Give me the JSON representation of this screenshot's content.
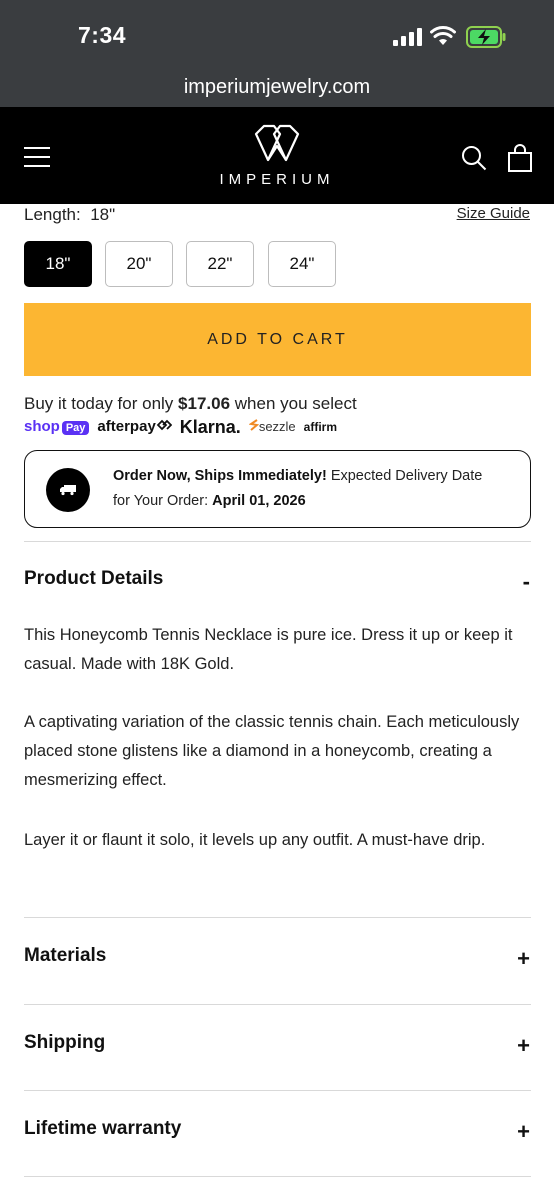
{
  "status_bar": {
    "time": "7:34"
  },
  "browser": {
    "url": "imperiumjewelry.com"
  },
  "header": {
    "brand": "IMPERIUM"
  },
  "product": {
    "length_label": "Length:",
    "length_value": "18\"",
    "size_guide": "Size Guide",
    "sizes": [
      "18\"",
      "20\"",
      "22\"",
      "24\""
    ],
    "selected_size": "18\"",
    "add_to_cart": "ADD TO CART"
  },
  "financing": {
    "prefix": "Buy it today for only",
    "amount": "$17.06",
    "suffix": "when you select",
    "providers": {
      "shop": "shop",
      "pay": "Pay",
      "afterpay": "afterpay",
      "klarna": "Klarna.",
      "sezzle": "sezzle",
      "affirm": "affirm"
    }
  },
  "delivery": {
    "bold1": "Order Now, Ships Immediately!",
    "text1": " Expected Delivery Date",
    "text2": "for Your Order: ",
    "date": "April 01, 2026"
  },
  "details": {
    "title": "Product Details",
    "toggle": "-",
    "paragraphs": [
      "This Honeycomb Tennis Necklace is pure ice. Dress it up or keep it casual. Made with 18K Gold.",
      "A captivating variation of the classic tennis chain. Each meticulously placed stone glistens like a diamond in a honeycomb, creating a mesmerizing effect.",
      "Layer it or flaunt it solo, it levels up any outfit. A must-have drip."
    ]
  },
  "accordion": [
    {
      "title": "Materials",
      "toggle": "+"
    },
    {
      "title": "Shipping",
      "toggle": "+"
    },
    {
      "title": "Lifetime warranty",
      "toggle": "+"
    }
  ]
}
